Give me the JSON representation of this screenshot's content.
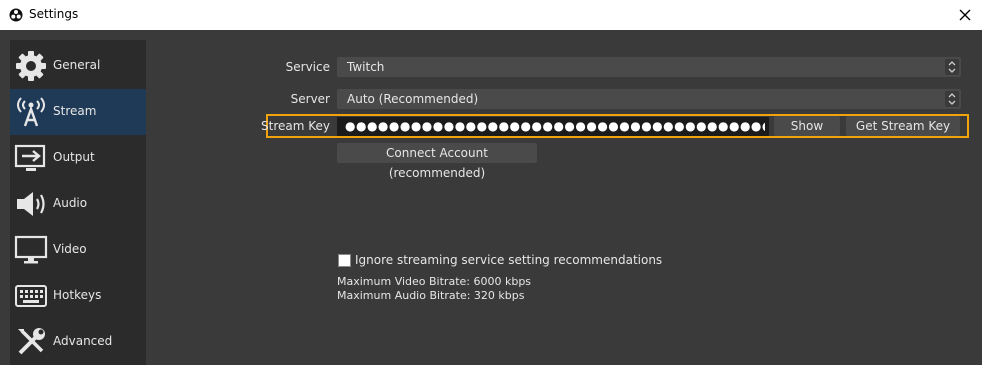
{
  "window": {
    "title": "Settings",
    "app_icon": "obs-logo-icon",
    "close_icon": "close-icon"
  },
  "sidebar": {
    "items": [
      {
        "label": "General",
        "icon": "gear-icon",
        "active": false
      },
      {
        "label": "Stream",
        "icon": "antenna-icon",
        "active": true
      },
      {
        "label": "Output",
        "icon": "output-icon",
        "active": false
      },
      {
        "label": "Audio",
        "icon": "speaker-icon",
        "active": false
      },
      {
        "label": "Video",
        "icon": "monitor-icon",
        "active": false
      },
      {
        "label": "Hotkeys",
        "icon": "keyboard-icon",
        "active": false
      },
      {
        "label": "Advanced",
        "icon": "tools-icon",
        "active": false
      }
    ]
  },
  "stream": {
    "service_label": "Service",
    "service_value": "Twitch",
    "server_label": "Server",
    "server_value": "Auto (Recommended)",
    "stream_key_label": "Stream Key",
    "stream_key_value": "●●●●●●●●●●●●●●●●●●●●●●●●●●●●●●●●●●●●●●●●●●●●●●",
    "show_button": "Show",
    "get_key_button": "Get Stream Key",
    "connect_button": "Connect Account (recommended)",
    "ignore_checkbox_label": "Ignore streaming service setting recommendations",
    "ignore_checked": false,
    "max_video_bitrate": "Maximum Video Bitrate: 6000 kbps",
    "max_audio_bitrate": "Maximum Audio Bitrate: 320 kbps"
  },
  "colors": {
    "highlight": "#f0a30a",
    "active_item": "#1f3a57",
    "background": "#3a3a3a",
    "sidebar": "#2b2b2b"
  }
}
